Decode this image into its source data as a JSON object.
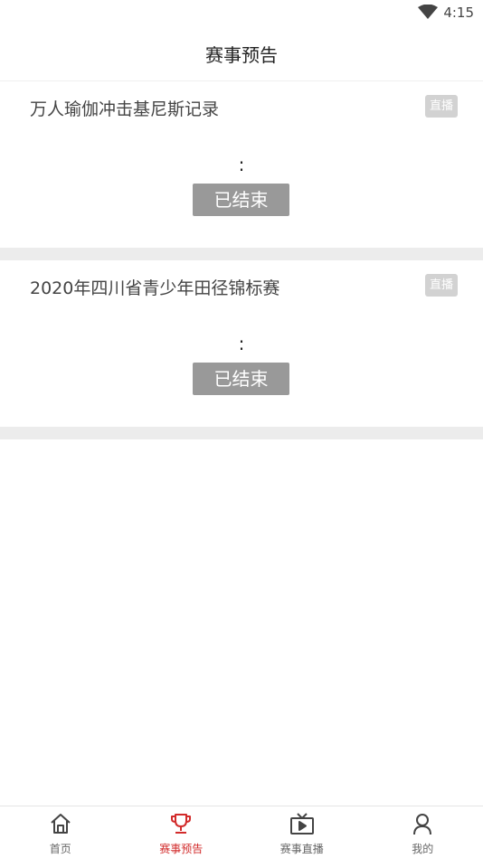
{
  "status_bar": {
    "time": "4:15"
  },
  "header": {
    "title": "赛事预告"
  },
  "events": [
    {
      "name": "万人瑜伽冲击基尼斯记录",
      "badge": "直播",
      "colon": ":",
      "status": "已结束"
    },
    {
      "name": "2020年四川省青少年田径锦标赛",
      "badge": "直播",
      "colon": ":",
      "status": "已结束"
    }
  ],
  "tabbar": {
    "tabs": [
      {
        "label": "首页",
        "icon": "home-icon"
      },
      {
        "label": "赛事预告",
        "icon": "trophy-icon",
        "active": true
      },
      {
        "label": "赛事直播",
        "icon": "tv-play-icon"
      },
      {
        "label": "我的",
        "icon": "person-icon"
      }
    ]
  },
  "colors": {
    "accent": "#d22b2b",
    "badge_bg": "#d2d2d2",
    "button_bg": "#999999",
    "separator": "#ececec"
  }
}
